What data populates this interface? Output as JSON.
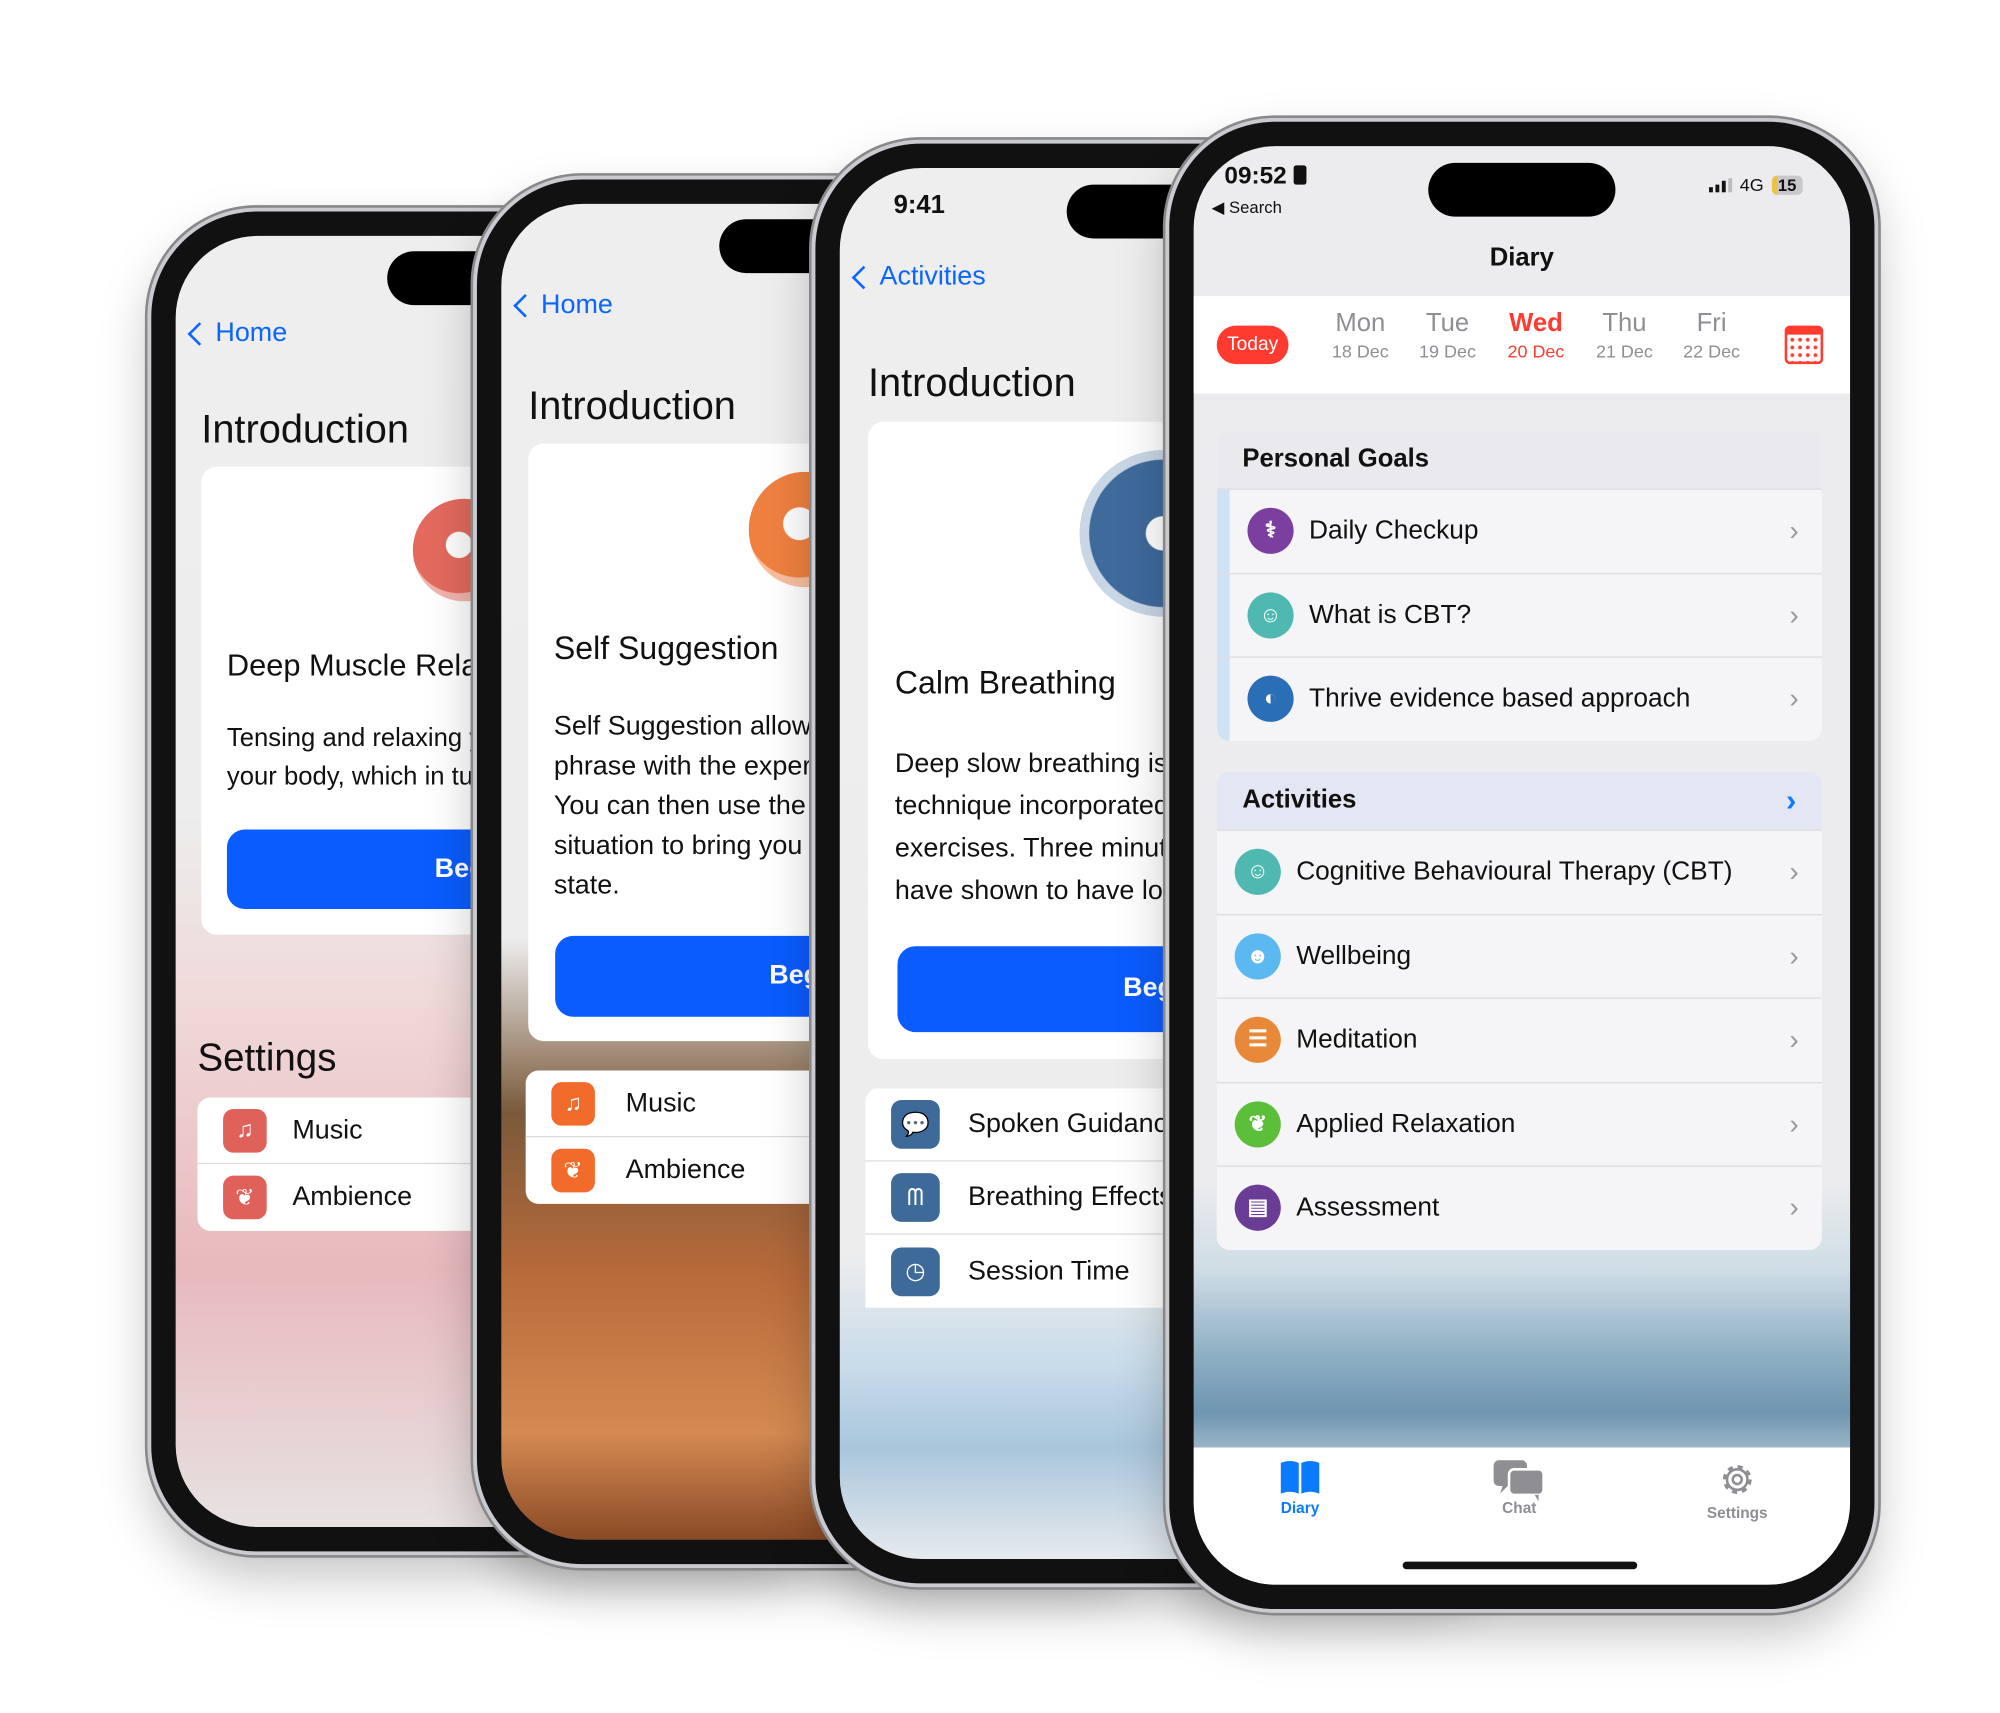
{
  "phone1": {
    "back": "Home",
    "intro": "Introduction",
    "title": "Deep Muscle Relax",
    "body": [
      "Tensing and relaxing yo",
      "your body, which in turn"
    ],
    "button": "Beg",
    "settings_heading": "Settings",
    "settings": [
      {
        "label": "Music",
        "icon": "music-note-icon"
      },
      {
        "label": "Ambience",
        "icon": "leaf-icon"
      }
    ],
    "accent": "#e0605a"
  },
  "phone2": {
    "back": "Home",
    "intro": "Introduction",
    "title": "Self Suggestion",
    "body": [
      "Self Suggestion allows",
      "phrase with the experie",
      "You can then use the w",
      "situation to bring you b",
      "state."
    ],
    "button": "Beg",
    "settings": [
      {
        "label": "Music",
        "icon": "music-note-icon"
      },
      {
        "label": "Ambience",
        "icon": "leaf-icon"
      }
    ],
    "accent": "#f26b2a"
  },
  "phone3": {
    "time": "9:41",
    "back": "Activities",
    "intro": "Introduction",
    "title": "Calm Breathing",
    "body": [
      "Deep slow breathing is",
      "technique incorporated",
      "exercises. Three minut",
      "have shown to have lon"
    ],
    "button": "Beg",
    "settings": [
      {
        "label": "Spoken Guidance",
        "icon": "speech-bubble-icon"
      },
      {
        "label": "Breathing Effects",
        "icon": "lungs-icon"
      },
      {
        "label": "Session Time",
        "icon": "timer-icon"
      }
    ],
    "accent": "#3e6a9a"
  },
  "phone4": {
    "status": {
      "time": "09:52",
      "back_app": "Search",
      "network": "4G",
      "battery": "15"
    },
    "title": "Diary",
    "today_label": "Today",
    "days": [
      {
        "day": "Mon",
        "date": "18 Dec"
      },
      {
        "day": "Tue",
        "date": "19 Dec"
      },
      {
        "day": "Wed",
        "date": "20 Dec",
        "selected": true
      },
      {
        "day": "Thu",
        "date": "21 Dec"
      },
      {
        "day": "Fri",
        "date": "22 Dec"
      }
    ],
    "goals": {
      "heading": "Personal Goals",
      "items": [
        {
          "label": "Daily Checkup",
          "icon": "stethoscope-icon",
          "color": "#7b3fa0"
        },
        {
          "label": "What is CBT?",
          "icon": "head-icon",
          "color": "#4fb8b0"
        },
        {
          "label": "Thrive evidence based approach",
          "icon": "thrive-logo-icon",
          "color": "#2a6fb5"
        }
      ]
    },
    "activities": {
      "heading": "Activities",
      "items": [
        {
          "label": "Cognitive Behavioural Therapy (CBT)",
          "icon": "head-icon",
          "color": "#4fb8b0"
        },
        {
          "label": "Wellbeing",
          "icon": "person-icon",
          "color": "#5bb8f0"
        },
        {
          "label": "Meditation",
          "icon": "stones-icon",
          "color": "#e8893a"
        },
        {
          "label": "Applied Relaxation",
          "icon": "leaf-icon",
          "color": "#5cbf3a"
        },
        {
          "label": "Assessment",
          "icon": "clipboard-icon",
          "color": "#6b3c95"
        }
      ]
    },
    "tabs": [
      {
        "label": "Diary",
        "icon": "book-icon",
        "active": true
      },
      {
        "label": "Chat",
        "icon": "chat-bubbles-icon"
      },
      {
        "label": "Settings",
        "icon": "gear-icon"
      }
    ],
    "colors": {
      "accent": "#0a7aff",
      "today": "#ff3b30"
    }
  }
}
